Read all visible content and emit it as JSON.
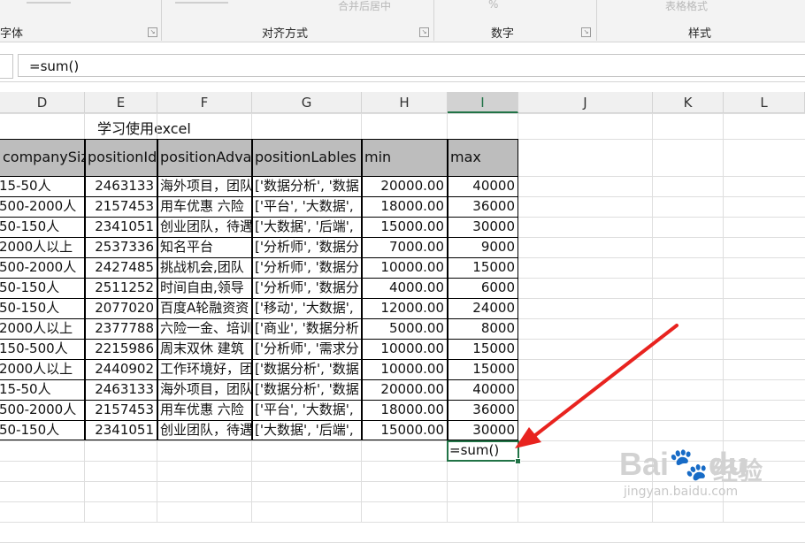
{
  "ribbon": {
    "groups": [
      {
        "label": "字体"
      },
      {
        "label": "对齐方式"
      },
      {
        "label": "数字"
      },
      {
        "label": "样式"
      }
    ],
    "merge_label": "合并后居中",
    "percent_label": "%",
    "table_format_label": "表格格式"
  },
  "formula_bar": {
    "value": "=sum()"
  },
  "columns": [
    "D",
    "E",
    "F",
    "G",
    "H",
    "I",
    "J",
    "K",
    "L"
  ],
  "sheet": {
    "title": "学习使用excel",
    "headers": [
      "companySize",
      "positionId",
      "positionAdvantage",
      "positionLables",
      "min",
      "max"
    ],
    "rows": [
      [
        "15-50人",
        "2463133",
        "海外项目，团队",
        "['数据分析', '数据",
        "20000.00",
        "40000"
      ],
      [
        "500-2000人",
        "2157453",
        "用车优惠 六险",
        "['平台', '大数据',",
        "18000.00",
        "36000"
      ],
      [
        "50-150人",
        "2341051",
        "创业团队，待遇",
        "['大数据', '后端',",
        "15000.00",
        "30000"
      ],
      [
        "2000人以上",
        "2537336",
        "知名平台",
        "['分析师', '数据分",
        "7000.00",
        "9000"
      ],
      [
        "500-2000人",
        "2427485",
        "挑战机会,团队",
        "['分析师', '数据分",
        "10000.00",
        "15000"
      ],
      [
        "50-150人",
        "2511252",
        "时间自由,领导",
        "['分析师', '数据分",
        "4000.00",
        "6000"
      ],
      [
        "50-150人",
        "2077020",
        "百度A轮融资资",
        "['移动', '大数据',",
        "12000.00",
        "24000"
      ],
      [
        "2000人以上",
        "2377788",
        "六险一金、培训",
        "['商业', '数据分析",
        "5000.00",
        "8000"
      ],
      [
        "150-500人",
        "2215986",
        "周末双休 建筑",
        "['分析师', '需求分",
        "10000.00",
        "15000"
      ],
      [
        "2000人以上",
        "2440902",
        "工作环境好，团",
        "['数据分析', '数据",
        "10000.00",
        "15000"
      ],
      [
        "15-50人",
        "2463133",
        "海外项目，团队",
        "['数据分析', '数据",
        "20000.00",
        "40000"
      ],
      [
        "500-2000人",
        "2157453",
        "用车优惠 六险",
        "['平台', '大数据',",
        "18000.00",
        "36000"
      ],
      [
        "50-150人",
        "2341051",
        "创业团队，待遇",
        "['大数据', '后端',",
        "15000.00",
        "30000"
      ]
    ],
    "active_cell_text": "=sum()"
  },
  "colors": {
    "header_fill": "#bdbdbd",
    "selection": "#217346",
    "arrow": "#e8231f"
  },
  "watermark": {
    "logo_text": "Bai",
    "logo_text2": "du",
    "logo_cn": "经验",
    "url": "jingyan.baidu.com"
  }
}
